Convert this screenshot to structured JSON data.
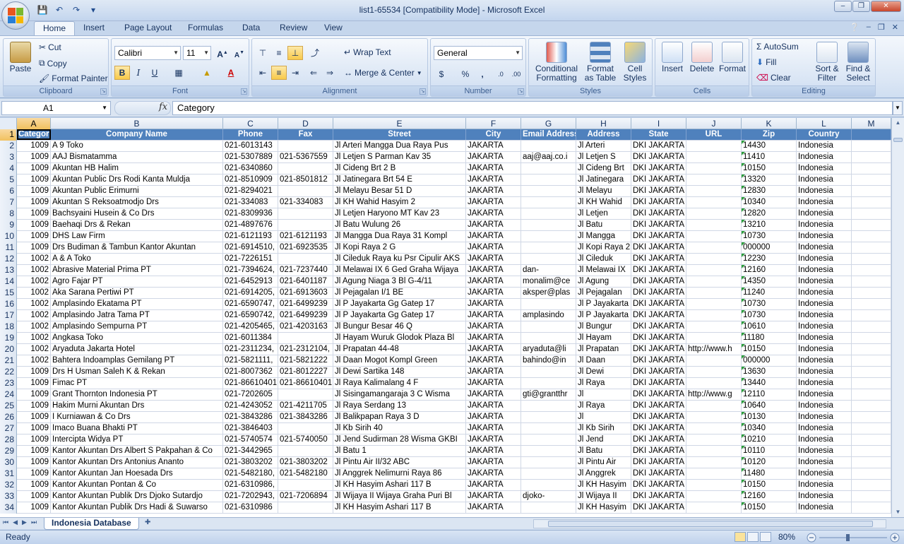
{
  "window": {
    "title": "list1-65534  [Compatibility Mode] - Microsoft Excel"
  },
  "ribbon": {
    "tabs": [
      "Home",
      "Insert",
      "Page Layout",
      "Formulas",
      "Data",
      "Review",
      "View"
    ],
    "clipboard": {
      "label": "Clipboard",
      "paste": "Paste",
      "cut": "Cut",
      "copy": "Copy",
      "format_painter": "Format Painter"
    },
    "font": {
      "label": "Font",
      "family": "Calibri",
      "size": "11"
    },
    "alignment": {
      "label": "Alignment",
      "wrap_text": "Wrap Text",
      "merge_center": "Merge & Center"
    },
    "number": {
      "label": "Number",
      "format": "General"
    },
    "styles": {
      "label": "Styles",
      "conditional": "Conditional",
      "conditional2": "Formatting",
      "format_as": "Format",
      "format_as2": "as Table",
      "cell_styles": "Cell",
      "cell_styles2": "Styles"
    },
    "cells": {
      "label": "Cells",
      "insert": "Insert",
      "delete": "Delete",
      "format": "Format"
    },
    "editing": {
      "label": "Editing",
      "autosum": "AutoSum",
      "fill": "Fill",
      "clear": "Clear",
      "sort": "Sort &",
      "sort2": "Filter",
      "find": "Find &",
      "find2": "Select"
    }
  },
  "formula_bar": {
    "name_box": "A1",
    "formula": "Category"
  },
  "columns": [
    "A",
    "B",
    "C",
    "D",
    "E",
    "F",
    "G",
    "H",
    "I",
    "J",
    "K",
    "L",
    "M"
  ],
  "headers": [
    "Category",
    "Company Name",
    "Phone",
    "Fax",
    "Street",
    "City",
    "Email Address",
    "Address",
    "State",
    "URL",
    "Zip",
    "Country"
  ],
  "rows": [
    [
      "1009",
      "A 9 Toko",
      "021-6013143",
      "",
      "Jl Arteri Mangga Dua Raya Pus",
      "JAKARTA",
      "",
      "Jl Arteri",
      "DKI JAKARTA",
      "",
      "14430",
      "Indonesia"
    ],
    [
      "1009",
      "AAJ Bismatamma",
      "021-5307889",
      "021-5367559",
      "Jl Letjen S Parman Kav 35",
      "JAKARTA",
      "aaj@aaj.co.i",
      "Jl Letjen S",
      "DKI JAKARTA",
      "",
      "11410",
      "Indonesia"
    ],
    [
      "1009",
      "Akuntan HB Halim",
      "021-6340860",
      "",
      "Jl Cideng Brt 2 B",
      "JAKARTA",
      "",
      "Jl Cideng Brt",
      "DKI JAKARTA",
      "",
      "10150",
      "Indonesia"
    ],
    [
      "1009",
      "Akuntan Public Drs Rodi Kanta Muldja",
      "021-8510909",
      "021-8501812",
      "Jl Jatinegara Brt 54 E",
      "JAKARTA",
      "",
      "Jl Jatinegara",
      "DKI JAKARTA",
      "",
      "13320",
      "Indonesia"
    ],
    [
      "1009",
      "Akuntan Public Erimurni",
      "021-8294021",
      "",
      "Jl Melayu Besar 51 D",
      "JAKARTA",
      "",
      "Jl Melayu",
      "DKI JAKARTA",
      "",
      "12830",
      "Indonesia"
    ],
    [
      "1009",
      "Akuntan S Reksoatmodjo Drs",
      "021-334083",
      "021-334083",
      "Jl KH Wahid Hasyim 2",
      "JAKARTA",
      "",
      "Jl KH Wahid",
      "DKI JAKARTA",
      "",
      "10340",
      "Indonesia"
    ],
    [
      "1009",
      "Bachsyaini Husein & Co Drs",
      "021-8309936",
      "",
      "Jl Letjen Haryono MT Kav 23",
      "JAKARTA",
      "",
      "Jl Letjen",
      "DKI JAKARTA",
      "",
      "12820",
      "Indonesia"
    ],
    [
      "1009",
      "Baehaqi Drs & Rekan",
      "021-4897676",
      "",
      "Jl Batu Wulung 26",
      "JAKARTA",
      "",
      "Jl Batu",
      "DKI JAKARTA",
      "",
      "13210",
      "Indonesia"
    ],
    [
      "1009",
      "DHS Law Firm",
      "021-6121193",
      "021-6121193",
      "Jl Mangga Dua Raya 31 Kompl",
      "JAKARTA",
      "",
      "Jl Mangga",
      "DKI JAKARTA",
      "",
      "10730",
      "Indonesia"
    ],
    [
      "1009",
      "Drs Budiman & Tambun Kantor Akuntan",
      "021-6914510,",
      "021-6923535",
      "Jl Kopi Raya 2 G",
      "JAKARTA",
      "",
      "Jl Kopi Raya 2",
      "DKI JAKARTA",
      "",
      "000000",
      "Indonesia"
    ],
    [
      "1002",
      "A & A Toko",
      "021-7226151",
      "",
      "Jl Cileduk Raya ku Psr Cipulir AKS",
      "JAKARTA",
      "",
      "Jl Cileduk",
      "DKI JAKARTA",
      "",
      "12230",
      "Indonesia"
    ],
    [
      "1002",
      "Abrasive Material Prima PT",
      "021-7394624,",
      "021-7237440",
      "Jl Melawai IX 6 Ged Graha Wijaya",
      "JAKARTA",
      "dan-",
      "Jl Melawai IX",
      "DKI JAKARTA",
      "",
      "12160",
      "Indonesia"
    ],
    [
      "1002",
      "Agro Fajar PT",
      "021-6452913",
      "021-6401187",
      "Jl Agung Niaga 3 Bl G-4/11",
      "JAKARTA",
      "monalim@ce",
      "Jl Agung",
      "DKI JAKARTA",
      "",
      "14350",
      "Indonesia"
    ],
    [
      "1002",
      "Aka Sarana Pertiwi PT",
      "021-6914205,",
      "021-6913603",
      "Jl Pejagalan I/1 BE",
      "JAKARTA",
      "aksper@plas",
      "Jl Pejagalan",
      "DKI JAKARTA",
      "",
      "11240",
      "Indonesia"
    ],
    [
      "1002",
      "Amplasindo Ekatama PT",
      "021-6590747,",
      "021-6499239",
      "Jl P Jayakarta Gg Gatep 17",
      "JAKARTA",
      "",
      "Jl P Jayakarta",
      "DKI JAKARTA",
      "",
      "10730",
      "Indonesia"
    ],
    [
      "1002",
      "Amplasindo Jatra Tama PT",
      "021-6590742,",
      "021-6499239",
      "Jl P Jayakarta Gg Gatep 17",
      "JAKARTA",
      "amplasindo",
      "Jl P Jayakarta",
      "DKI JAKARTA",
      "",
      "10730",
      "Indonesia"
    ],
    [
      "1002",
      "Amplasindo Sempurna PT",
      "021-4205465,",
      "021-4203163",
      "Jl Bungur Besar 46 Q",
      "JAKARTA",
      "",
      "Jl Bungur",
      "DKI JAKARTA",
      "",
      "10610",
      "Indonesia"
    ],
    [
      "1002",
      "Angkasa Toko",
      "021-6011384",
      "",
      "Jl Hayam Wuruk Glodok Plaza Bl",
      "JAKARTA",
      "",
      "Jl Hayam",
      "DKI JAKARTA",
      "",
      "11180",
      "Indonesia"
    ],
    [
      "1002",
      "Aryaduta Jakarta Hotel",
      "021-2311234,",
      "021-2312104,",
      "Jl Prapatan 44-48",
      "JAKARTA",
      "aryaduta@li",
      "Jl Prapatan",
      "DKI JAKARTA",
      "http://www.h",
      "10150",
      "Indonesia"
    ],
    [
      "1002",
      "Bahtera Indoamplas Gemilang PT",
      "021-5821111,",
      "021-5821222",
      "Jl Daan Mogot Kompl Green",
      "JAKARTA",
      "bahindo@in",
      "Jl Daan",
      "DKI JAKARTA",
      "",
      "000000",
      "Indonesia"
    ],
    [
      "1009",
      "Drs H Usman Saleh K & Rekan",
      "021-8007362",
      "021-8012227",
      "Jl Dewi Sartika 148",
      "JAKARTA",
      "",
      "Jl Dewi",
      "DKI JAKARTA",
      "",
      "13630",
      "Indonesia"
    ],
    [
      "1009",
      "Fimac PT",
      "021-86610401,",
      "021-86610401",
      "Jl Raya Kalimalang 4 F",
      "JAKARTA",
      "",
      "Jl Raya",
      "DKI JAKARTA",
      "",
      "13440",
      "Indonesia"
    ],
    [
      "1009",
      "Grant Thornton Indonesia PT",
      "021-7202605",
      "",
      "Jl Sisingamangaraja 3 C Wisma",
      "JAKARTA",
      "gti@grantthr",
      "Jl",
      "DKI JAKARTA",
      "http://www.g",
      "12110",
      "Indonesia"
    ],
    [
      "1009",
      "Hakim Murni Akuntan Drs",
      "021-4243052",
      "021-4211705",
      "Jl Raya Serdang 13",
      "JAKARTA",
      "",
      "Jl Raya",
      "DKI JAKARTA",
      "",
      "10640",
      "Indonesia"
    ],
    [
      "1009",
      "I Kurniawan & Co Drs",
      "021-3843286",
      "021-3843286",
      "Jl Balikpapan Raya 3 D",
      "JAKARTA",
      "",
      "Jl",
      "DKI JAKARTA",
      "",
      "10130",
      "Indonesia"
    ],
    [
      "1009",
      "Imaco Buana Bhakti PT",
      "021-3846403",
      "",
      "Jl Kb Sirih 40",
      "JAKARTA",
      "",
      "Jl Kb Sirih",
      "DKI JAKARTA",
      "",
      "10340",
      "Indonesia"
    ],
    [
      "1009",
      "Intercipta Widya PT",
      "021-5740574",
      "021-5740050",
      "Jl Jend Sudirman 28 Wisma GKBI",
      "JAKARTA",
      "",
      "Jl Jend",
      "DKI JAKARTA",
      "",
      "10210",
      "Indonesia"
    ],
    [
      "1009",
      "Kantor Akuntan Drs Albert S Pakpahan & Co",
      "021-3442965",
      "",
      "Jl Batu 1",
      "JAKARTA",
      "",
      "Jl Batu",
      "DKI JAKARTA",
      "",
      "10110",
      "Indonesia"
    ],
    [
      "1009",
      "Kantor Akuntan Drs Antonius Ananto",
      "021-3803202",
      "021-3803202",
      "Jl Pintu Air II/32 ABC",
      "JAKARTA",
      "",
      "Jl Pintu Air",
      "DKI JAKARTA",
      "",
      "10120",
      "Indonesia"
    ],
    [
      "1009",
      "Kantor Akuntan Jan Hoesada Drs",
      "021-5482180,",
      "021-5482180",
      "Jl Anggrek Nelimurni Raya 86",
      "JAKARTA",
      "",
      "Jl Anggrek",
      "DKI JAKARTA",
      "",
      "11480",
      "Indonesia"
    ],
    [
      "1009",
      "Kantor Akuntan Pontan & Co",
      "021-6310986,",
      "",
      "Jl KH Hasyim Ashari 117 B",
      "JAKARTA",
      "",
      "Jl KH Hasyim",
      "DKI JAKARTA",
      "",
      "10150",
      "Indonesia"
    ],
    [
      "1009",
      "Kantor Akuntan Publik Drs Djoko Sutardjo",
      "021-7202943,",
      "021-7206894",
      "Jl Wijaya II Wijaya Graha Puri Bl",
      "JAKARTA",
      "djoko-",
      "Jl Wijaya II",
      "DKI JAKARTA",
      "",
      "12160",
      "Indonesia"
    ],
    [
      "1009",
      "Kantor Akuntan Publik Drs Hadi & Suwarso",
      "021-6310986",
      "",
      "Jl KH Hasyim Ashari 117 B",
      "JAKARTA",
      "",
      "Jl KH Hasyim",
      "DKI JAKARTA",
      "",
      "10150",
      "Indonesia"
    ]
  ],
  "sheet_tab": "Indonesia Database",
  "status": {
    "text": "Ready",
    "zoom": "80%"
  }
}
